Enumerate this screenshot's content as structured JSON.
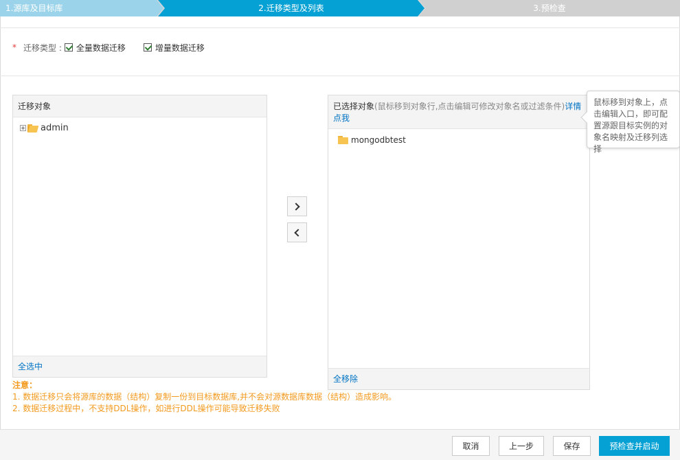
{
  "steps": [
    "1.源库及目标库",
    "2.迁移类型及列表",
    "3.预检查"
  ],
  "migration_type": {
    "required_mark": "*",
    "label": "迁移类型 :",
    "options": [
      {
        "label": "全量数据迁移",
        "checked": true
      },
      {
        "label": "增量数据迁移",
        "checked": true
      }
    ]
  },
  "left_panel": {
    "title": "迁移对象",
    "tree": [
      {
        "label": "admin",
        "icon": "folder-open-icon"
      }
    ],
    "footer": "全选中"
  },
  "right_panel": {
    "title": "已选择对象",
    "hint": "(鼠标移到对象行,点击编辑可修改对象名或过滤条件)",
    "link": "详情点我",
    "items": [
      {
        "label": "mongodbtest",
        "icon": "folder-icon"
      }
    ],
    "footer": "全移除"
  },
  "transfer": {
    "add_icon": "chevron-right-icon",
    "remove_icon": "chevron-left-icon"
  },
  "tooltip": "鼠标移到对象上，点击编辑入口，即可配置源跟目标实例的对象名映射及迁移列选择",
  "notes": {
    "title": "注意：",
    "lines": [
      "1. 数据迁移只会将源库的数据（结构）复制一份到目标数据库,并不会对源数据库数据（结构）造成影响。",
      "2. 数据迁移过程中，不支持DDL操作，如进行DDL操作可能导致迁移失败"
    ]
  },
  "buttons": {
    "cancel": "取消",
    "prev": "上一步",
    "save": "保存",
    "start": "预检查并启动"
  },
  "colors": {
    "step_done": "#9bd4ea",
    "step_active": "#05a1d4",
    "step_todo": "#d0d0d0",
    "link": "#0073c4",
    "note": "#f39a1e",
    "primary": "#05a1d4"
  }
}
